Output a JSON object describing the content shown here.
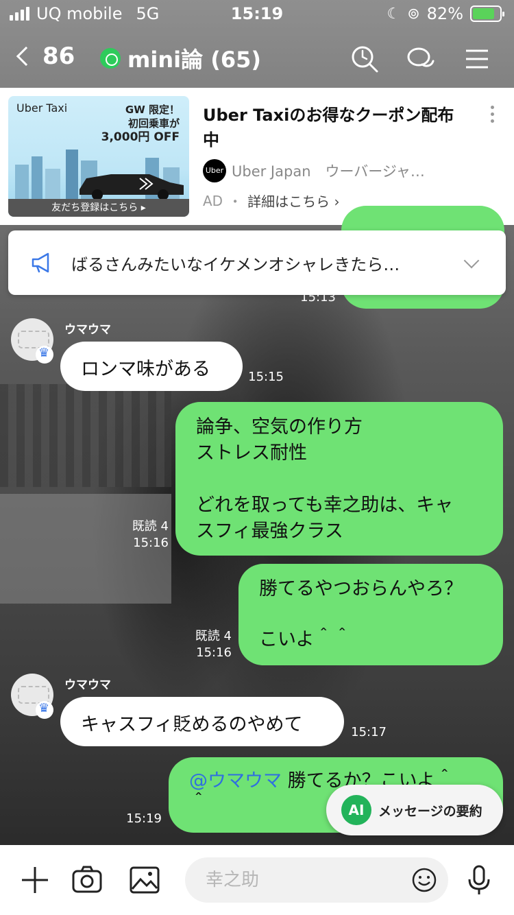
{
  "status_bar": {
    "carrier": "UQ mobile",
    "network": "5G",
    "time": "15:19",
    "battery_percent": "82%",
    "battery_level": 0.82
  },
  "header": {
    "back_count": "86",
    "chat_title": "mini論 (65)",
    "icons": [
      "search-icon",
      "chat-bubbles-icon",
      "menu-icon"
    ]
  },
  "ad": {
    "image_brand": "Uber Taxi",
    "image_promo_line1": "GW 限定！",
    "image_promo_line2": "初回乗車が",
    "image_promo_line3": "3,000円 OFF",
    "image_cta": "友だち登録はこちら ▸",
    "title": "Uber Taxiのお得なクーポン配布中",
    "brand_logo_text": "Uber",
    "brand": "Uber Japan　ウーバージャ…",
    "ad_label": "AD",
    "separator": "・",
    "link_text": "詳細はこちら ›"
  },
  "announcement": {
    "text": "ばるさんみたいなイケメンオシャレきたら…"
  },
  "messages": [
    {
      "type": "sent",
      "time": "15:13"
    },
    {
      "type": "received",
      "sender": "ウマウマ",
      "text": "ロンマ味がある",
      "time": "15:15"
    },
    {
      "type": "sent",
      "line1": "論争、空気の作り方",
      "line2": "ストレス耐性",
      "line3": "どれを取っても幸之助は、キャ",
      "line4": "スフィ最強クラス",
      "read": "既読 4",
      "time": "15:16"
    },
    {
      "type": "sent",
      "line1": "勝てるやつおらんやろ？",
      "line2": "こいよ＾＾",
      "read": "既読 4",
      "time": "15:16"
    },
    {
      "type": "received",
      "sender": "ウマウマ",
      "text": "キャスフィ貶めるのやめて",
      "time": "15:17"
    },
    {
      "type": "sent",
      "mention": "@ウマウマ",
      "text": " 勝てるか？こいよ＾",
      "text2": "＾",
      "time": "15:19"
    }
  ],
  "summary_button": {
    "ai": "AI",
    "label": "メッセージの要約"
  },
  "input": {
    "placeholder": "幸之助"
  },
  "colors": {
    "sent_bubble": "#6fe274",
    "received_bubble": "#ffffff",
    "accent": "#22b35a",
    "mention": "#2f6fe0"
  }
}
